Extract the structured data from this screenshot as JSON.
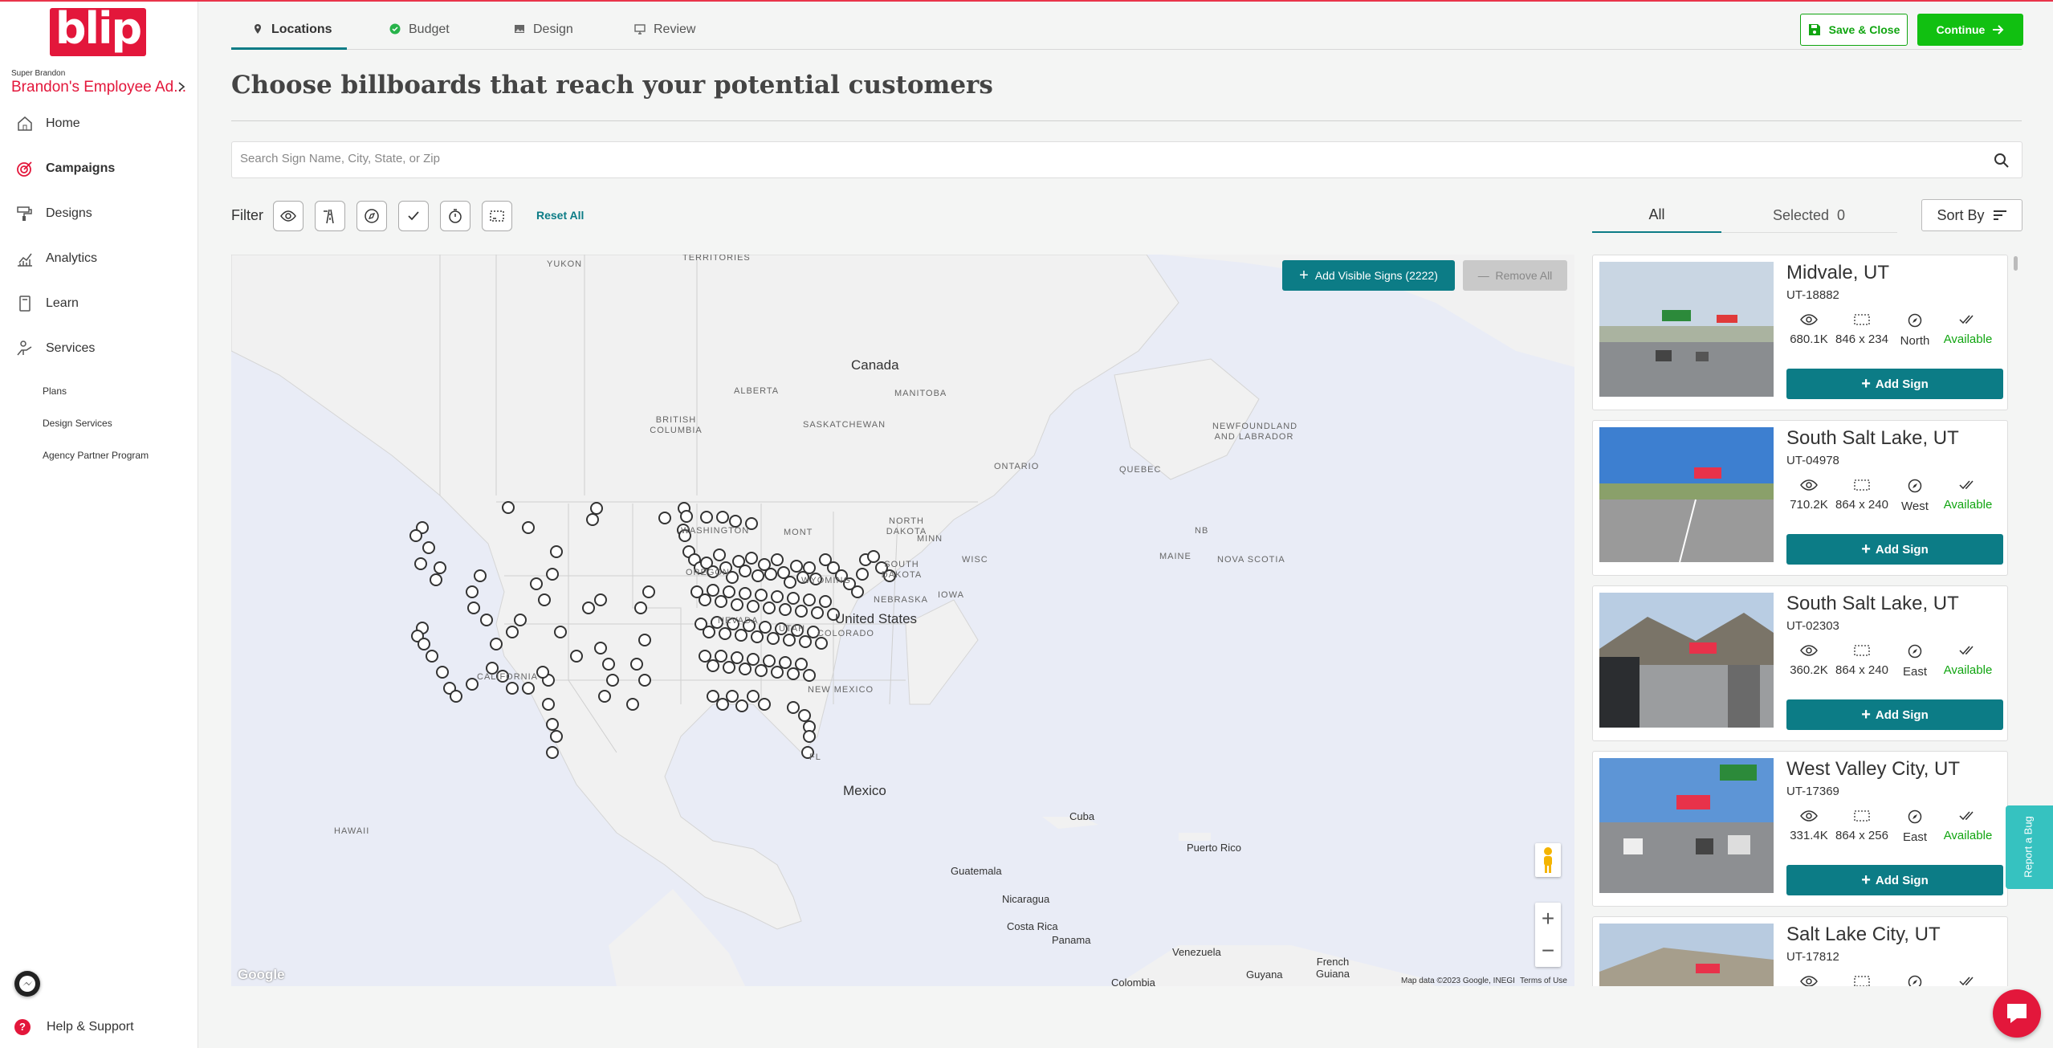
{
  "brand": {
    "logo_text": "blip",
    "user_role": "Super Brandon",
    "account_name": "Brandon's Employee Ad..."
  },
  "sidebar": {
    "items": [
      {
        "label": "Home",
        "icon": "home-icon"
      },
      {
        "label": "Campaigns",
        "icon": "target-icon",
        "active": true
      },
      {
        "label": "Designs",
        "icon": "paint-roller-icon"
      },
      {
        "label": "Analytics",
        "icon": "analytics-icon"
      },
      {
        "label": "Learn",
        "icon": "book-icon"
      },
      {
        "label": "Services",
        "icon": "services-icon"
      }
    ],
    "subitems": [
      "Plans",
      "Design Services",
      "Agency Partner Program"
    ],
    "help_label": "Help & Support"
  },
  "tabs": [
    {
      "label": "Locations",
      "icon": "pin-icon",
      "active": true
    },
    {
      "label": "Budget",
      "icon": "check-circle-icon"
    },
    {
      "label": "Design",
      "icon": "image-icon"
    },
    {
      "label": "Review",
      "icon": "monitor-icon"
    }
  ],
  "actions": {
    "save_close": "Save & Close",
    "continue": "Continue"
  },
  "page_title": "Choose billboards that reach your potential customers",
  "search": {
    "placeholder": "Search Sign Name, City, State, or Zip",
    "value": ""
  },
  "filter": {
    "label": "Filter",
    "reset": "Reset All"
  },
  "list_tabs": {
    "all": "All",
    "selected_label": "Selected",
    "selected_count": "0",
    "sort": "Sort By"
  },
  "map": {
    "add_visible": "Add Visible Signs (2222)",
    "remove_all": "Remove All",
    "labels": [
      "TERRITORIES",
      "YUKON",
      "Canada",
      "ALBERTA",
      "MANITOBA",
      "BRITISH COLUMBIA",
      "SASKATCHEWAN",
      "ONTARIO",
      "QUEBEC",
      "NEWFOUNDLAND AND LABRADOR",
      "NB",
      "NOVA SCOTIA",
      "MAINE",
      "WASHINGTON",
      "MONT",
      "NORTH DAKOTA",
      "MINN",
      "OREGON",
      "WYOMING",
      "SOUTH DAKOTA",
      "WISC",
      "NEVADA",
      "UTAH",
      "COLORADO",
      "NEBRASKA",
      "IOWA",
      "United States",
      "NEW MEXICO",
      "Mexico",
      "Cuba",
      "Puerto Rico",
      "HAWAII",
      "Guatemala",
      "Nicaragua",
      "Costa Rica",
      "Panama",
      "Venezuela",
      "Guyana",
      "French Guiana",
      "Colombia",
      "FL",
      "CALIFORNIA"
    ],
    "attribution": "Map data ©2023 Google, INEGI",
    "terms": "Terms of Use",
    "google": "Google"
  },
  "signs": [
    {
      "city": "Midvale, UT",
      "code": "UT-18882",
      "impressions": "680.1K",
      "size": "846 x 234",
      "facing": "North",
      "status": "Available",
      "add": "Add Sign"
    },
    {
      "city": "South Salt Lake, UT",
      "code": "UT-04978",
      "impressions": "710.2K",
      "size": "864 x 240",
      "facing": "West",
      "status": "Available",
      "add": "Add Sign"
    },
    {
      "city": "South Salt Lake, UT",
      "code": "UT-02303",
      "impressions": "360.2K",
      "size": "864 x 240",
      "facing": "East",
      "status": "Available",
      "add": "Add Sign"
    },
    {
      "city": "West Valley City, UT",
      "code": "UT-17369",
      "impressions": "331.4K",
      "size": "864 x 256",
      "facing": "East",
      "status": "Available",
      "add": "Add Sign"
    },
    {
      "city": "Salt Lake City, UT",
      "code": "UT-17812",
      "impressions": "",
      "size": "",
      "facing": "",
      "status": "",
      "add": ""
    }
  ],
  "report_bug": "Report a Bug",
  "colors": {
    "brand_red": "#e3173b",
    "teal": "#0c7c86",
    "green": "#11c011",
    "available": "#11a511"
  }
}
